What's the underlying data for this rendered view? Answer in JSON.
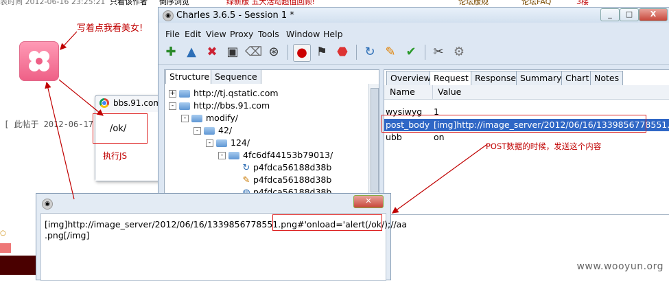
{
  "background_page": {
    "top_fragments": [
      "表时间 2012-06-16 23:25:21",
      "只看该作者",
      "倒序浏览",
      "绿新版 五大活动超值回顾!",
      "论坛版规",
      "论坛FAQ",
      "3楼"
    ],
    "annotation_top": "写着点我看美女!",
    "posted_text": "[ 此帖于 2012-06-17",
    "logo_icon": "pink-clover-icon",
    "watermark": "www.wooyun.org"
  },
  "chrome_popup": {
    "title": "bbs.91.com",
    "alert_text": "/ok/",
    "run_js_label": "执行JS"
  },
  "charles": {
    "title": "Charles 3.6.5 - Session 1 *",
    "window_buttons": [
      "_",
      "□",
      "X"
    ],
    "menu": [
      "File",
      "Edit",
      "View",
      "Proxy",
      "Tools",
      "Window",
      "Help"
    ],
    "left_tabs": [
      "Structure",
      "Sequence"
    ],
    "tree": [
      {
        "label": "http://tj.qstatic.com",
        "depth": 0,
        "expander": "+",
        "kind": "folder"
      },
      {
        "label": "http://bbs.91.com",
        "depth": 0,
        "expander": "-",
        "kind": "folder"
      },
      {
        "label": "modify/",
        "depth": 1,
        "expander": "-",
        "kind": "folder"
      },
      {
        "label": "42/",
        "depth": 2,
        "expander": "-",
        "kind": "folder"
      },
      {
        "label": "124/",
        "depth": 3,
        "expander": "-",
        "kind": "folder"
      },
      {
        "label": "4fc6df44153b79013/",
        "depth": 4,
        "expander": "-",
        "kind": "folder"
      },
      {
        "label": "p4fdca56188d38b",
        "depth": 5,
        "expander": "",
        "kind": "refresh"
      },
      {
        "label": "p4fdca56188d38b",
        "depth": 5,
        "expander": "",
        "kind": "pencil"
      },
      {
        "label": "p4fdca56188d38b",
        "depth": 5,
        "expander": "",
        "kind": "globe"
      }
    ],
    "right_tabs": [
      "Overview",
      "Request",
      "Response",
      "Summary",
      "Chart",
      "Notes"
    ],
    "table": {
      "headers": [
        "Name",
        "Value"
      ],
      "rows": [
        {
          "name": "wysiwyg",
          "value": "1"
        },
        {
          "name": "post_body",
          "value": "[img]http://image_server/2012/06/16/1339856778551...."
        },
        {
          "name": "ubb",
          "value": "on"
        }
      ]
    },
    "post_note": "POST数据的时候，发送这个内容"
  },
  "edit_window": {
    "line1_a": "[img]http://image_server/2012/06/16/1339856778551.png",
    "line1_b": "#'onload='alert(/ok/);//aa",
    "line2": ".png[/img]"
  },
  "colors": {
    "annotation_red": "#c00000",
    "selection_blue": "#2f67c6",
    "window_frame": "#dde7f3"
  }
}
